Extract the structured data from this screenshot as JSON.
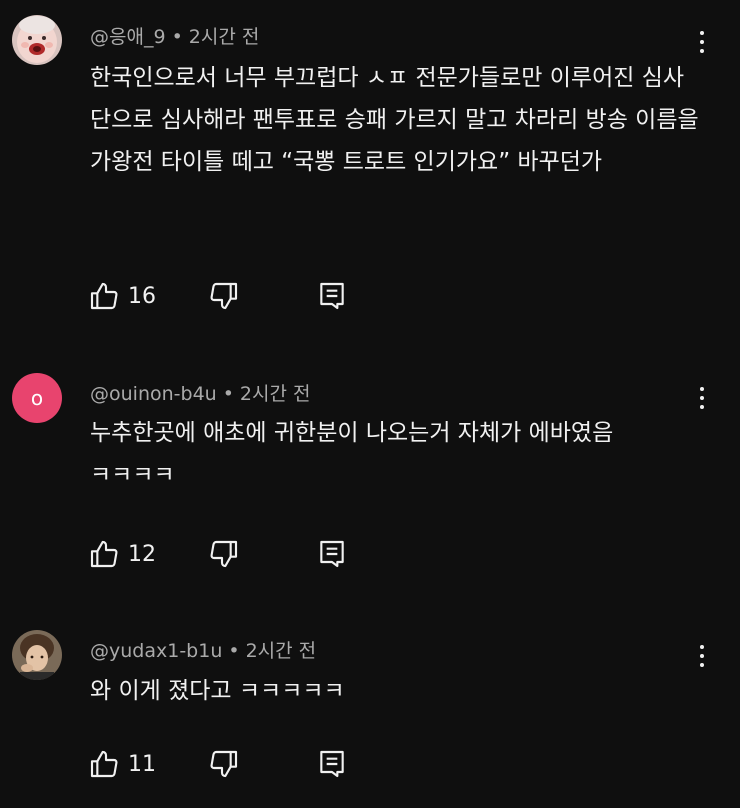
{
  "comments": [
    {
      "author": "@응애_9",
      "time": "2시간 전",
      "text": "한국인으로서 너무 부끄럽다 ㅅㅍ 전문가들로만 이루어진 심사단으로 심사해라 팬투표로 승패 가르지 말고 차라리 방송 이름을 가왕전 타이틀 떼고 “국뽕 트로트 인기가요” 바꾸던가",
      "likes": "16",
      "avatar_icon": "baby-face-icon"
    },
    {
      "author": "@ouinon-b4u",
      "time": "2시간 전",
      "text": "누추한곳에 애초에 귀한분이 나오는거 자체가 에바였음ㅋㅋㅋㅋ",
      "likes": "12",
      "avatar_letter": "o",
      "avatar_color": "#e8446e"
    },
    {
      "author": "@yudax1-b1u",
      "time": "2시간 전",
      "text": "와 이게 졌다고 ㅋㅋㅋㅋㅋ",
      "likes": "11",
      "avatar_icon": "person-photo-icon"
    }
  ],
  "separator": "•",
  "colors": {
    "background": "#0f0f0f",
    "text": "#f1f1f1",
    "meta": "#aaaaaa"
  },
  "icons": {
    "like": "thumbs-up-icon",
    "dislike": "thumbs-down-icon",
    "reply": "reply-icon",
    "more": "more-vert-icon"
  }
}
